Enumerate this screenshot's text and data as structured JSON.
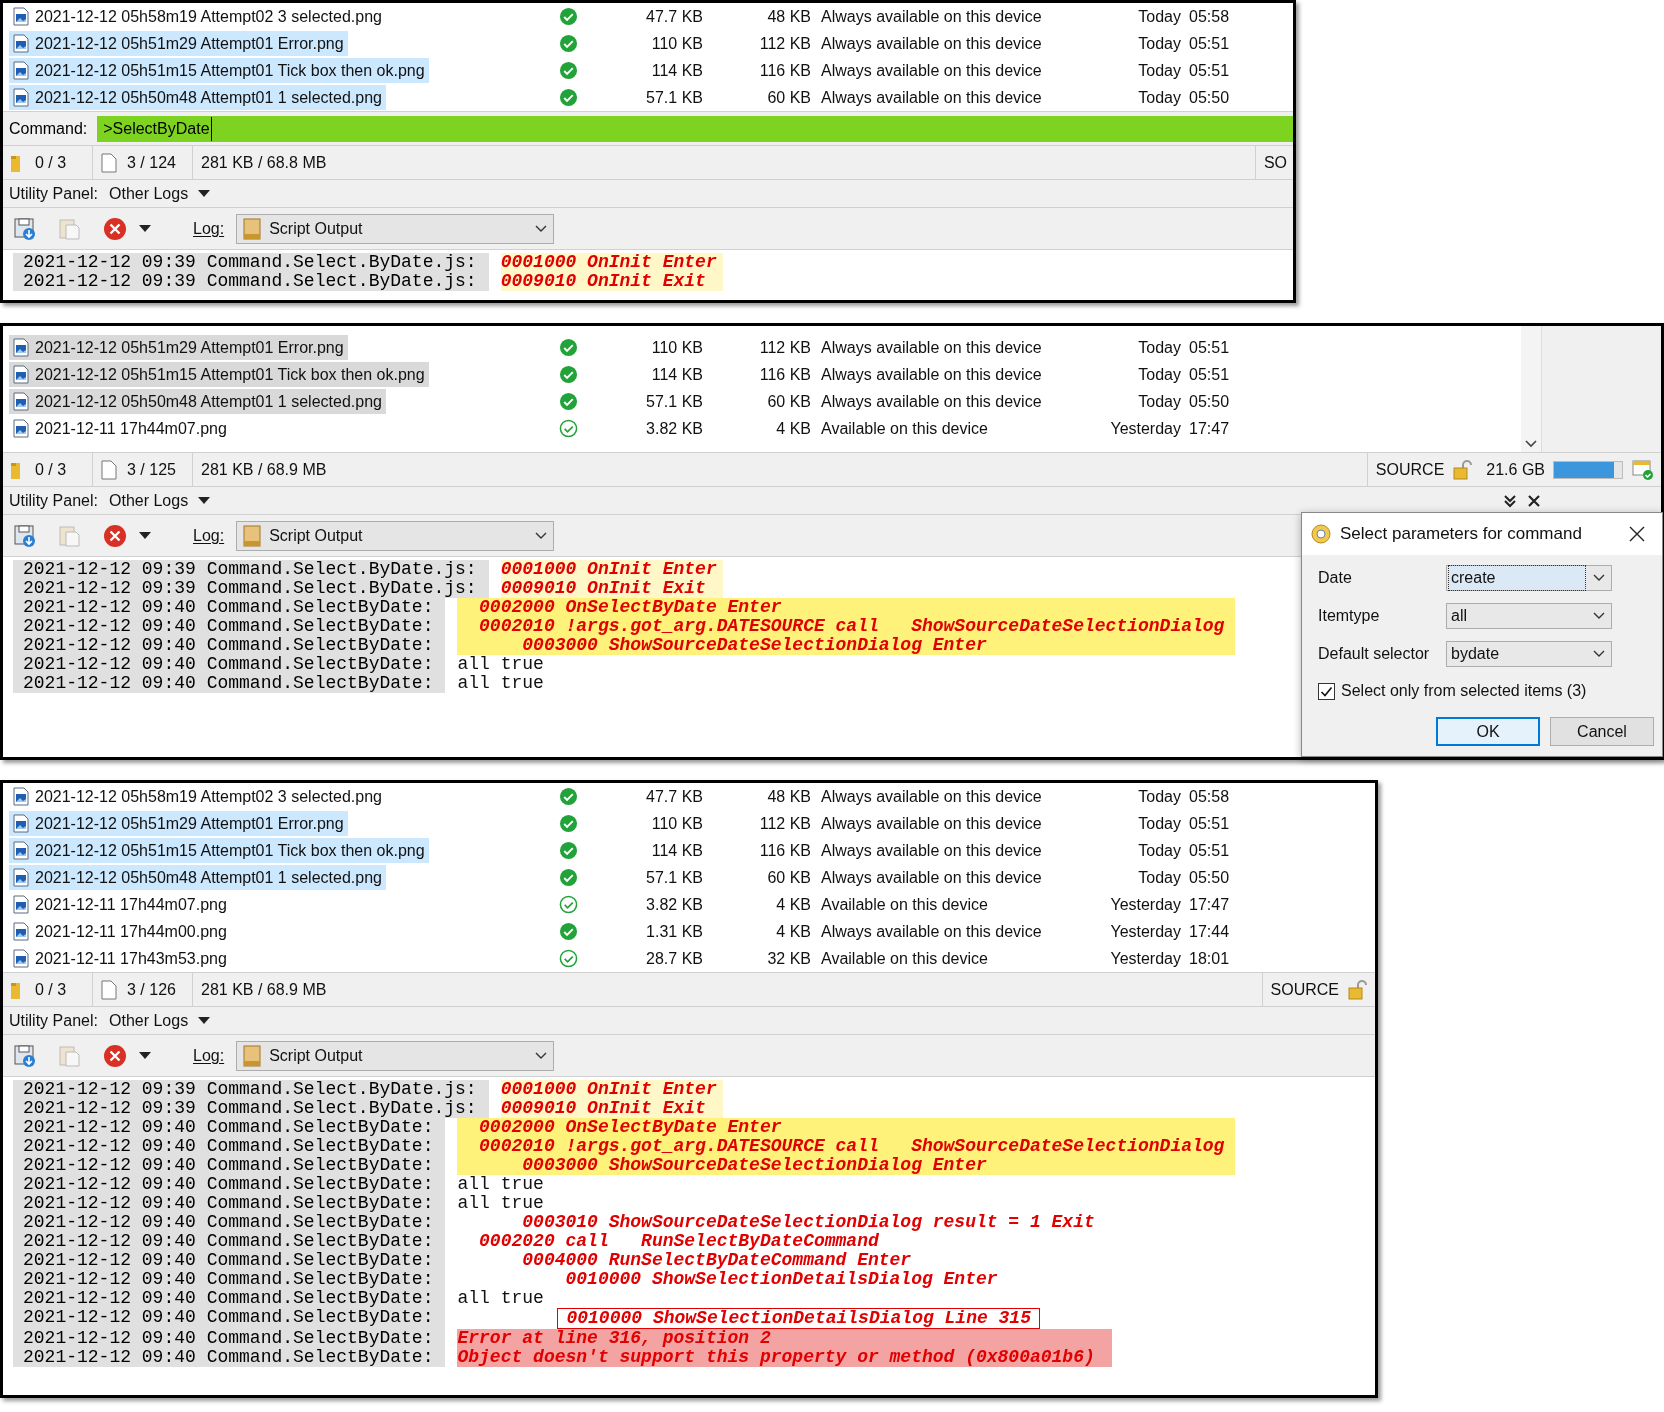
{
  "panels": [
    {
      "list_focused": true,
      "files": [
        {
          "name": "2021-12-12 05h58m19 Attempt02 3 selected.png",
          "selected": false,
          "kind": "always",
          "size": "47.7 KB",
          "disk": "48 KB",
          "availability": "Always available on this device",
          "day": "Today",
          "time": "05:58"
        },
        {
          "name": "2021-12-12 05h51m29 Attempt01 Error.png",
          "selected": true,
          "kind": "always",
          "size": "110 KB",
          "disk": "112 KB",
          "availability": "Always available on this device",
          "day": "Today",
          "time": "05:51"
        },
        {
          "name": "2021-12-12 05h51m15 Attempt01 Tick box then ok.png",
          "selected": true,
          "kind": "always",
          "size": "114 KB",
          "disk": "116 KB",
          "availability": "Always available on this device",
          "day": "Today",
          "time": "05:51"
        },
        {
          "name": "2021-12-12 05h50m48 Attempt01 1 selected.png",
          "selected": true,
          "kind": "always",
          "size": "57.1 KB",
          "disk": "60 KB",
          "availability": "Always available on this device",
          "day": "Today",
          "time": "05:50"
        }
      ],
      "command": {
        "label": "Command:",
        "value": ">SelectByDate"
      },
      "status_bar": {
        "folders": "0 / 3",
        "files": "3 / 124",
        "size": "281 KB / 68.8 MB",
        "source": "SO"
      },
      "utility_panel": {
        "label": "Utility Panel:",
        "value": "Other Logs"
      },
      "log_bar": {
        "label": "Log:",
        "value": "Script Output"
      },
      "log": [
        {
          "meta": "2021-12-12 09:39 Command.Select.ByDate.js:",
          "message": "0001000 OnInit Enter",
          "kind": "pale"
        },
        {
          "meta": "2021-12-12 09:39 Command.Select.ByDate.js:",
          "message": "0009010 OnInit Exit",
          "kind": "pale"
        }
      ]
    },
    {
      "list_focused": false,
      "scrollbar": true,
      "pane_buttons": true,
      "files": [
        {
          "name": "2021-12-12 05h51m29 Attempt01 Error.png",
          "selected": true,
          "kind": "always",
          "size": "110 KB",
          "disk": "112 KB",
          "availability": "Always available on this device",
          "day": "Today",
          "time": "05:51"
        },
        {
          "name": "2021-12-12 05h51m15 Attempt01 Tick box then ok.png",
          "selected": true,
          "kind": "always",
          "size": "114 KB",
          "disk": "116 KB",
          "availability": "Always available on this device",
          "day": "Today",
          "time": "05:51"
        },
        {
          "name": "2021-12-12 05h50m48 Attempt01 1 selected.png",
          "selected": true,
          "kind": "always",
          "size": "57.1 KB",
          "disk": "60 KB",
          "availability": "Always available on this device",
          "day": "Today",
          "time": "05:50"
        },
        {
          "name": "2021-12-11 17h44m07.png",
          "selected": false,
          "kind": "available",
          "size": "3.82 KB",
          "disk": "4 KB",
          "availability": "Available on this device",
          "day": "Yesterday",
          "time": "17:47"
        }
      ],
      "status_bar": {
        "folders": "0 / 3",
        "files": "3 / 125",
        "size": "281 KB / 68.9 MB",
        "source": "SOURCE",
        "lock": true,
        "free": "21.6 GB",
        "level": 0.88
      },
      "utility_panel": {
        "label": "Utility Panel:",
        "value": "Other Logs"
      },
      "log_bar": {
        "label": "Log:",
        "value": "Script Output"
      },
      "log": [
        {
          "meta": "2021-12-12 09:39 Command.Select.ByDate.js:",
          "message": "0001000 OnInit Enter",
          "kind": "pale"
        },
        {
          "meta": "2021-12-12 09:39 Command.Select.ByDate.js:",
          "message": "0009010 OnInit Exit",
          "kind": "pale"
        },
        {
          "meta": "2021-12-12 09:40 Command.SelectByDate:",
          "message": "  0002000 OnSelectByDate Enter",
          "kind": "yellow"
        },
        {
          "meta": "2021-12-12 09:40 Command.SelectByDate:",
          "message": "  0002010 !args.got_arg.DATESOURCE call   ShowSourceDateSelectionDialog",
          "kind": "yellow"
        },
        {
          "meta": "2021-12-12 09:40 Command.SelectByDate:",
          "message": "      0003000 ShowSourceDateSelectionDialog Enter",
          "kind": "yellow"
        },
        {
          "meta": "2021-12-12 09:40 Command.SelectByDate:",
          "message": "all true",
          "kind": "plain"
        },
        {
          "meta": "2021-12-12 09:40 Command.SelectByDate:",
          "message": "all true",
          "kind": "plain"
        }
      ],
      "dialog": {
        "title": "Select parameters for command",
        "fields": [
          {
            "label": "Date",
            "value": "create",
            "focused": true
          },
          {
            "label": "Itemtype",
            "value": "all",
            "focused": false
          },
          {
            "label": "Default selector",
            "value": "bydate",
            "focused": false
          }
        ],
        "checkbox": {
          "label": "Select only from selected items (3)",
          "checked": true
        },
        "buttons": [
          {
            "label": "OK",
            "default": true
          },
          {
            "label": "Cancel",
            "default": false
          }
        ]
      }
    },
    {
      "list_focused": true,
      "files": [
        {
          "name": "2021-12-12 05h58m19 Attempt02 3 selected.png",
          "selected": false,
          "kind": "always",
          "size": "47.7 KB",
          "disk": "48 KB",
          "availability": "Always available on this device",
          "day": "Today",
          "time": "05:58"
        },
        {
          "name": "2021-12-12 05h51m29 Attempt01 Error.png",
          "selected": true,
          "kind": "always",
          "size": "110 KB",
          "disk": "112 KB",
          "availability": "Always available on this device",
          "day": "Today",
          "time": "05:51"
        },
        {
          "name": "2021-12-12 05h51m15 Attempt01 Tick box then ok.png",
          "selected": true,
          "kind": "always",
          "size": "114 KB",
          "disk": "116 KB",
          "availability": "Always available on this device",
          "day": "Today",
          "time": "05:51"
        },
        {
          "name": "2021-12-12 05h50m48 Attempt01 1 selected.png",
          "selected": true,
          "kind": "always",
          "size": "57.1 KB",
          "disk": "60 KB",
          "availability": "Always available on this device",
          "day": "Today",
          "time": "05:50"
        },
        {
          "name": "2021-12-11 17h44m07.png",
          "selected": false,
          "kind": "available",
          "size": "3.82 KB",
          "disk": "4 KB",
          "availability": "Available on this device",
          "day": "Yesterday",
          "time": "17:47"
        },
        {
          "name": "2021-12-11 17h44m00.png",
          "selected": false,
          "kind": "always",
          "size": "1.31 KB",
          "disk": "4 KB",
          "availability": "Always available on this device",
          "day": "Yesterday",
          "time": "17:44"
        },
        {
          "name": "2021-12-11 17h43m53.png",
          "selected": false,
          "kind": "available",
          "size": "28.7 KB",
          "disk": "32 KB",
          "availability": "Available on this device",
          "day": "Yesterday",
          "time": "18:01"
        }
      ],
      "status_bar": {
        "folders": "0 / 3",
        "files": "3 / 126",
        "size": "281 KB / 68.9 MB",
        "source": "SOURCE",
        "lock": true
      },
      "utility_panel": {
        "label": "Utility Panel:",
        "value": "Other Logs"
      },
      "log_bar": {
        "label": "Log:",
        "value": "Script Output"
      },
      "log": [
        {
          "meta": "2021-12-12 09:39 Command.Select.ByDate.js:",
          "message": "0001000 OnInit Enter",
          "kind": "pale"
        },
        {
          "meta": "2021-12-12 09:39 Command.Select.ByDate.js:",
          "message": "0009010 OnInit Exit",
          "kind": "pale"
        },
        {
          "meta": "2021-12-12 09:40 Command.SelectByDate:",
          "message": "  0002000 OnSelectByDate Enter",
          "kind": "yellow"
        },
        {
          "meta": "2021-12-12 09:40 Command.SelectByDate:",
          "message": "  0002010 !args.got_arg.DATESOURCE call   ShowSourceDateSelectionDialog",
          "kind": "yellow"
        },
        {
          "meta": "2021-12-12 09:40 Command.SelectByDate:",
          "message": "      0003000 ShowSourceDateSelectionDialog Enter",
          "kind": "yellow"
        },
        {
          "meta": "2021-12-12 09:40 Command.SelectByDate:",
          "message": "all true",
          "kind": "plain"
        },
        {
          "meta": "2021-12-12 09:40 Command.SelectByDate:",
          "message": "all true",
          "kind": "plain"
        },
        {
          "meta": "2021-12-12 09:40 Command.SelectByDate:",
          "message": "      0003010 ShowSourceDateSelectionDialog result = 1 Exit",
          "kind": "red"
        },
        {
          "meta": "2021-12-12 09:40 Command.SelectByDate:",
          "message": "  0002020 call   RunSelectByDateCommand",
          "kind": "red"
        },
        {
          "meta": "2021-12-12 09:40 Command.SelectByDate:",
          "message": "      0004000 RunSelectByDateCommand Enter",
          "kind": "red"
        },
        {
          "meta": "2021-12-12 09:40 Command.SelectByDate:",
          "message": "          0010000 ShowSelectionDetailsDialog Enter",
          "kind": "red"
        },
        {
          "meta": "2021-12-12 09:40 Command.SelectByDate:",
          "message": "all true",
          "kind": "plain"
        },
        {
          "meta": "2021-12-12 09:40 Command.SelectByDate:",
          "message": "0010000 ShowSelectionDetailsDialog Line 315",
          "kind": "boxed"
        },
        {
          "meta": "2021-12-12 09:40 Command.SelectByDate:",
          "message": "Error at line 316, position 2",
          "kind": "pink"
        },
        {
          "meta": "2021-12-12 09:40 Command.SelectByDate:",
          "message": "Object doesn't support this property or method (0x800a01b6)",
          "kind": "pink"
        }
      ]
    }
  ]
}
